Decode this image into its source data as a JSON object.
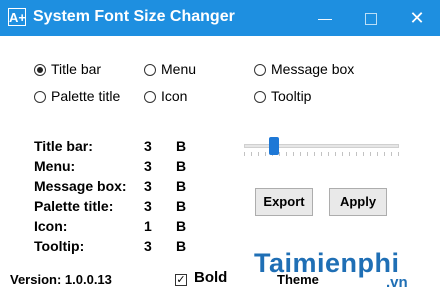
{
  "window": {
    "icon_text": "A+",
    "title": "System Font Size Changer",
    "min_label": "—",
    "max_label": "□",
    "close_label": "✕"
  },
  "radios": [
    {
      "label": "Title bar",
      "selected": true
    },
    {
      "label": "Menu",
      "selected": false
    },
    {
      "label": "Message box",
      "selected": false
    },
    {
      "label": "Palette title",
      "selected": false
    },
    {
      "label": "Icon",
      "selected": false
    },
    {
      "label": "Tooltip",
      "selected": false
    }
  ],
  "settings": [
    {
      "label": "Title bar:",
      "value": "3",
      "unit": "B"
    },
    {
      "label": "Menu:",
      "value": "3",
      "unit": "B"
    },
    {
      "label": "Message box:",
      "value": "3",
      "unit": "B"
    },
    {
      "label": "Palette title:",
      "value": "3",
      "unit": "B"
    },
    {
      "label": "Icon:",
      "value": "1",
      "unit": "B"
    },
    {
      "label": "Tooltip:",
      "value": "3",
      "unit": "B"
    }
  ],
  "slider": {
    "fraction": 0.17,
    "accent": "#1e78d6"
  },
  "buttons": {
    "export": "Export",
    "apply": "Apply"
  },
  "footer": {
    "version": "Version: 1.0.0.13",
    "bold_label": "Bold",
    "bold_checked": true,
    "check_mark": "✓",
    "theme_label": "Theme"
  },
  "watermark": {
    "name": "Taimienphi",
    "suffix": ".vn"
  },
  "colors": {
    "titlebar": "#1e8fe0"
  }
}
